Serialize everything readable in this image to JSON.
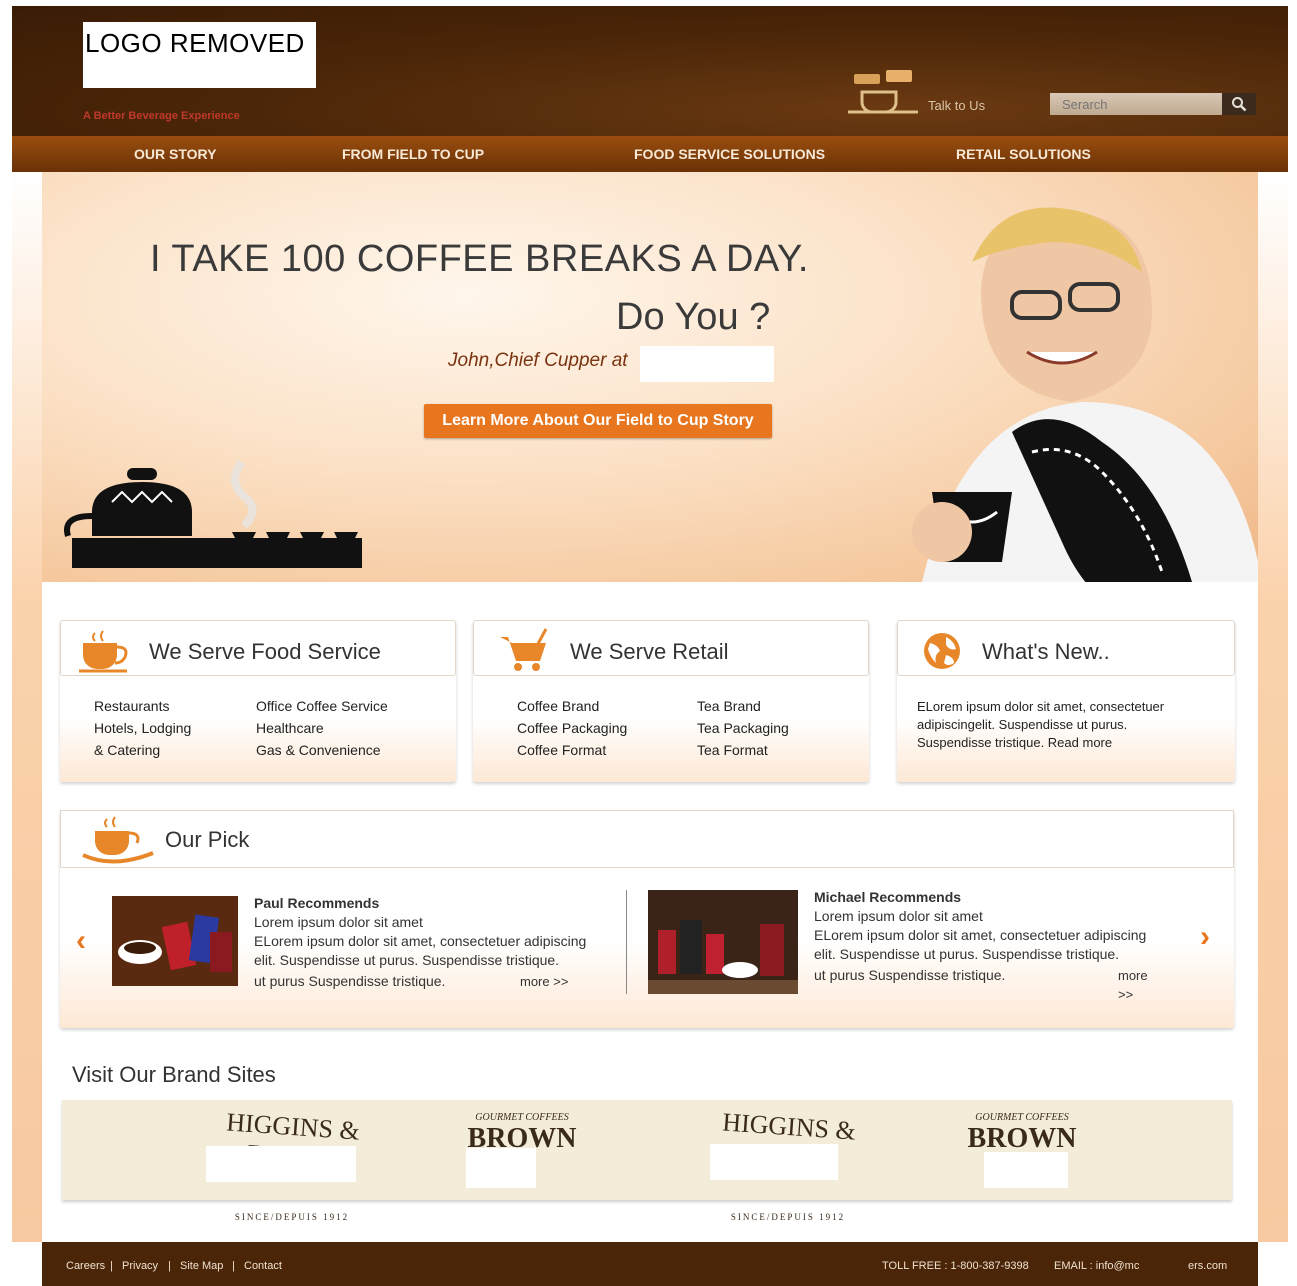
{
  "header": {
    "logo_text": "LOGO REMOVED",
    "tagline": "A Better Beverage Experience",
    "talk_label": "Talk to Us",
    "search_placeholder": "Serarch"
  },
  "nav": {
    "items": [
      "OUR STORY",
      "FROM FIELD TO CUP",
      "FOOD SERVICE SOLUTIONS",
      "RETAIL SOLUTIONS"
    ]
  },
  "hero": {
    "title": "I TAKE 100 COFFEE BREAKS A DAY.",
    "subtitle": "Do You ?",
    "attribution": "John,Chief Cupper at",
    "cta": "Learn More About Our Field to Cup Story"
  },
  "food_service": {
    "title": "We Serve Food Service",
    "col1": [
      "Restaurants",
      "Hotels, Lodging",
      "& Catering"
    ],
    "col2": [
      "Office Coffee Service",
      "Healthcare",
      "Gas & Convenience"
    ]
  },
  "retail": {
    "title": "We Serve Retail",
    "col1": [
      "Coffee Brand",
      "Coffee Packaging",
      "Coffee Format"
    ],
    "col2": [
      "Tea Brand",
      "Tea Packaging",
      "Tea Format"
    ]
  },
  "news": {
    "title": "What's New..",
    "lines": [
      "ELorem ipsum dolor sit amet, consectetuer",
      "adipiscingelit. Suspendisse ut purus.",
      "Suspendisse tristique. Read more"
    ]
  },
  "pick": {
    "title": "Our Pick",
    "left": {
      "heading": "Paul Recommends",
      "lines": [
        "Lorem ipsum dolor sit amet",
        "ELorem ipsum dolor sit amet, consectetuer adipiscing",
        "elit. Suspendisse ut purus. Suspendisse tristique.",
        "ut purus Suspendisse tristique."
      ],
      "more": "more >>"
    },
    "right": {
      "heading": "Michael Recommends",
      "lines": [
        "Lorem ipsum dolor sit amet",
        "ELorem ipsum dolor sit amet, consectetuer adipiscing",
        "elit. Suspendisse ut purus. Suspendisse tristique.",
        "ut purus Suspendisse tristique."
      ],
      "more": "more >>"
    }
  },
  "brands": {
    "title": "Visit Our Brand Sites",
    "items": [
      {
        "name": "HIGGINS & BURKE",
        "sub": "SINCE/DEPUIS 1912"
      },
      {
        "name": "BROWN",
        "sub": "GOURMET COFFEES"
      },
      {
        "name": "HIGGINS & BURKE",
        "sub": "SINCE/DEPUIS 1912"
      },
      {
        "name": "BROWN",
        "sub": "GOURMET COFFEES"
      }
    ]
  },
  "footer": {
    "links": [
      "Careers",
      "Privacy",
      "Site Map",
      "Contact"
    ],
    "toll_free": "TOLL FREE : 1-800-387-9398",
    "email": "EMAIL : info@mc",
    "domain_tail": "ers.com"
  }
}
